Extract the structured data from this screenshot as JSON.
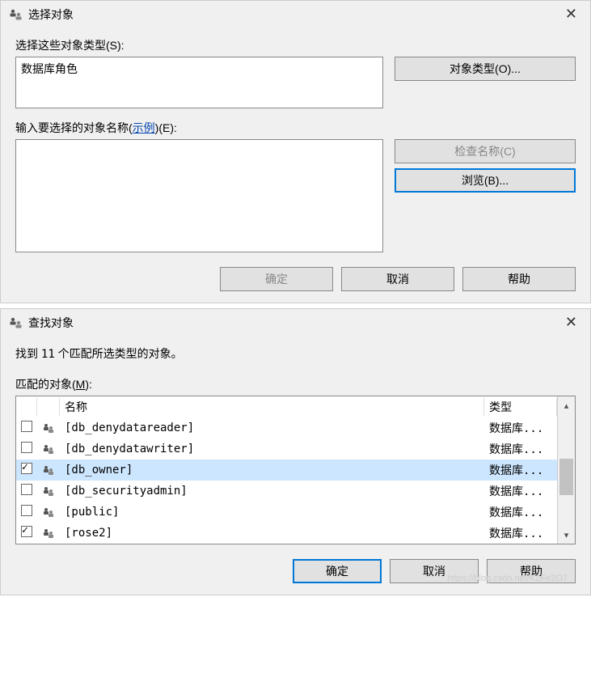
{
  "dialog1": {
    "title": "选择对象",
    "select_types_label": "选择这些对象类型(S):",
    "object_types_value": "数据库角色",
    "object_types_btn": "对象类型(O)...",
    "enter_names_label_prefix": "输入要选择的对象名称(",
    "enter_names_link": "示例",
    "enter_names_label_suffix": ")(E):",
    "check_names_btn": "检查名称(C)",
    "browse_btn": "浏览(B)...",
    "ok": "确定",
    "cancel": "取消",
    "help": "帮助"
  },
  "dialog2": {
    "title": "查找对象",
    "found_prefix": "找到 ",
    "found_count": "11",
    "found_suffix": " 个匹配所选类型的对象。",
    "matched_label_pre": "匹配的对象(",
    "matched_label_key": "M",
    "matched_label_post": "):",
    "col_name": "名称",
    "col_type": "类型",
    "rows": [
      {
        "checked": false,
        "name": "[db_denydatareader]",
        "type": "数据库...",
        "selected": false
      },
      {
        "checked": false,
        "name": "[db_denydatawriter]",
        "type": "数据库...",
        "selected": false
      },
      {
        "checked": true,
        "name": "[db_owner]",
        "type": "数据库...",
        "selected": true
      },
      {
        "checked": false,
        "name": "[db_securityadmin]",
        "type": "数据库...",
        "selected": false
      },
      {
        "checked": false,
        "name": "[public]",
        "type": "数据库...",
        "selected": false
      },
      {
        "checked": true,
        "name": "[rose2]",
        "type": "数据库...",
        "selected": false
      }
    ],
    "ok": "确定",
    "cancel": "取消",
    "help": "帮助"
  },
  "watermark": "https://blog.csdn.net/K2Fe2O7"
}
